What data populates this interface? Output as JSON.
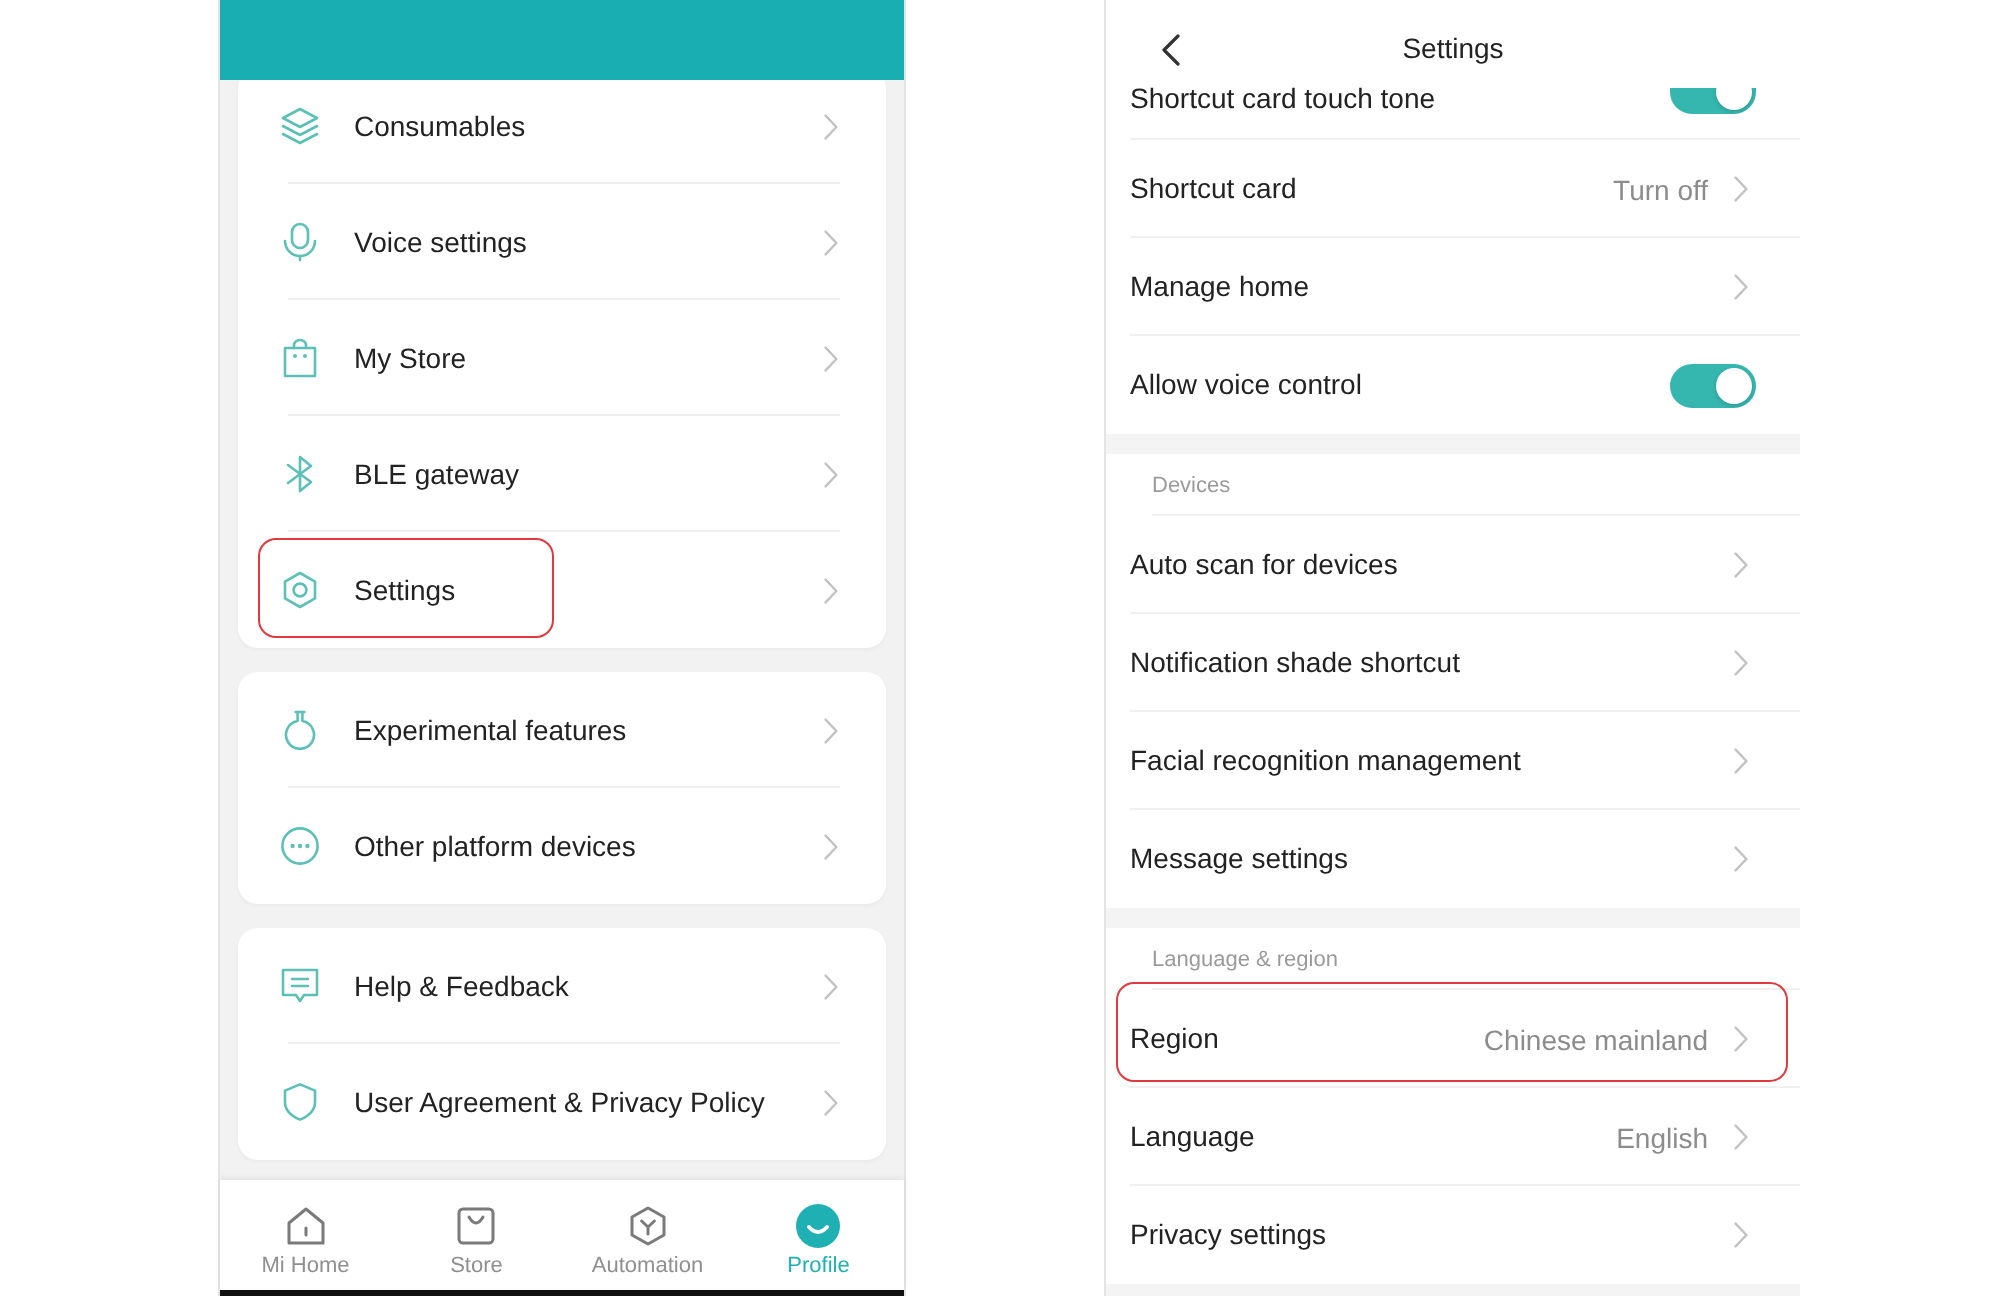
{
  "left_screen": {
    "groups": [
      {
        "items": [
          {
            "label": "Consumables",
            "highlighted": false
          },
          {
            "label": "Voice settings",
            "highlighted": false
          },
          {
            "label": "My Store",
            "highlighted": false
          },
          {
            "label": "BLE gateway",
            "highlighted": false
          },
          {
            "label": "Settings",
            "highlighted": true
          }
        ]
      },
      {
        "items": [
          {
            "label": "Experimental features",
            "highlighted": false
          },
          {
            "label": "Other platform devices",
            "highlighted": false
          }
        ]
      },
      {
        "items": [
          {
            "label": "Help & Feedback",
            "highlighted": false
          },
          {
            "label": "User Agreement & Privacy Policy",
            "highlighted": false
          }
        ]
      }
    ],
    "tab_bar": [
      {
        "label": "Mi Home",
        "selected": false
      },
      {
        "label": "Store",
        "selected": false
      },
      {
        "label": "Automation",
        "selected": false
      },
      {
        "label": "Profile",
        "selected": true
      }
    ]
  },
  "right_screen": {
    "title": "Settings",
    "sections": [
      {
        "rows": [
          {
            "kind": "toggle",
            "label": "Shortcut card touch tone",
            "on": true,
            "highlighted": false
          },
          {
            "kind": "link",
            "label": "Shortcut card",
            "value": "Turn off",
            "highlighted": false
          },
          {
            "kind": "link",
            "label": "Manage home",
            "highlighted": false
          },
          {
            "kind": "toggle",
            "label": "Allow voice control",
            "on": true,
            "highlighted": false
          }
        ]
      },
      {
        "header": "Devices",
        "rows": [
          {
            "kind": "link",
            "label": "Auto scan for devices",
            "highlighted": false
          },
          {
            "kind": "link",
            "label": "Notification shade shortcut",
            "highlighted": false
          },
          {
            "kind": "link",
            "label": "Facial recognition management",
            "highlighted": false
          },
          {
            "kind": "link",
            "label": "Message settings",
            "highlighted": false
          }
        ]
      },
      {
        "header": "Language & region",
        "rows": [
          {
            "kind": "link",
            "label": "Region",
            "value": "Chinese mainland",
            "highlighted": true
          },
          {
            "kind": "link",
            "label": "Language",
            "value": "English",
            "highlighted": false
          },
          {
            "kind": "link",
            "label": "Privacy settings",
            "highlighted": false
          }
        ]
      }
    ]
  }
}
